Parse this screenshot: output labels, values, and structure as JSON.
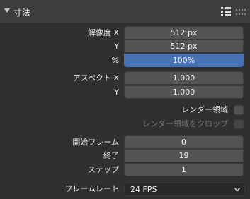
{
  "panel": {
    "title": "寸法",
    "collapse_icon": "chevron-down-icon",
    "list_icon": "list-icon",
    "drag_icon": "drag-handle-icon"
  },
  "resolution": {
    "x_label": "解像度 X",
    "x_value": "512 px",
    "y_label": "Y",
    "y_value": "512 px",
    "percent_label": "%",
    "percent_value": "100%"
  },
  "aspect": {
    "x_label": "アスペクト X",
    "x_value": "1.000",
    "y_label": "Y",
    "y_value": "1.000"
  },
  "render_region": {
    "label": "レンダー領域",
    "checked": false
  },
  "crop_to_region": {
    "label": "レンダー領域をクロップ",
    "checked": false,
    "enabled": false
  },
  "frames": {
    "start_label": "開始フレーム",
    "start_value": "0",
    "end_label": "終了",
    "end_value": "19",
    "step_label": "ステップ",
    "step_value": "1"
  },
  "frame_rate": {
    "label": "フレームレート",
    "value": "24 FPS"
  },
  "colors": {
    "background": "#303030",
    "field": "#545454",
    "active_field": "#4772b3"
  }
}
